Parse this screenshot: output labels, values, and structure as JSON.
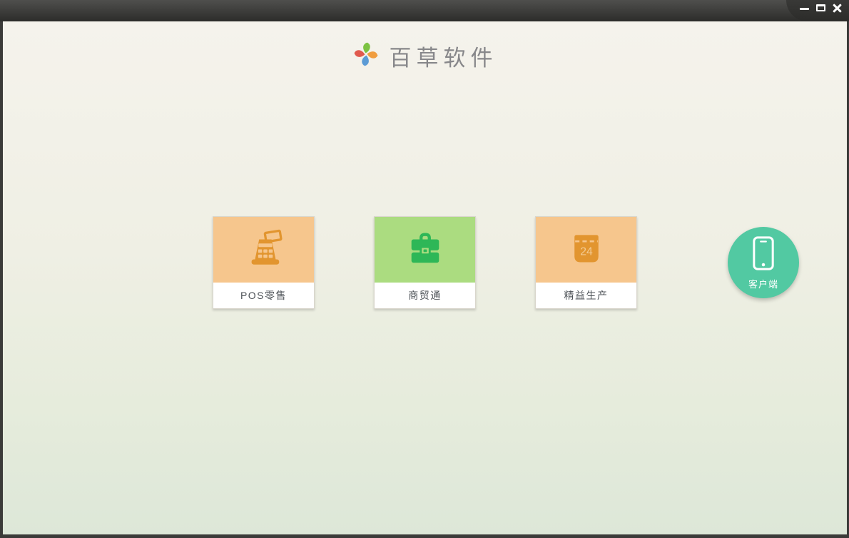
{
  "titlebar": {
    "controls": [
      {
        "name": "minimize"
      },
      {
        "name": "maximize"
      },
      {
        "name": "close"
      }
    ]
  },
  "header": {
    "app_name": "百草软件",
    "logo_icon": "pinwheel-icon",
    "logo_colors": {
      "green": "#7cc242",
      "orange": "#f09d3f",
      "blue": "#5b9bd5",
      "red": "#e05a4e"
    }
  },
  "products": [
    {
      "label": "POS零售",
      "icon": "cash-register-icon",
      "tile_color": "#f6c68d",
      "icon_color": "#e2952f"
    },
    {
      "label": "商贸通",
      "icon": "briefcase-icon",
      "tile_color": "#abdc80",
      "icon_color": "#2eb757"
    },
    {
      "label": "精益生产",
      "icon": "calendar-icon",
      "tile_color": "#f6c68d",
      "icon_color": "#e2952f",
      "calendar_day": "24"
    }
  ],
  "client_button": {
    "label": "客户端",
    "icon": "smartphone-icon",
    "color": "#52c9a2"
  },
  "colors": {
    "titlebar_top": "#4f4f4d",
    "titlebar_bottom": "#2c2c2a",
    "frame_border": "#3b3b39",
    "bg_top": "#f5f3ec",
    "bg_bottom": "#dde7d8",
    "card_label_text": "#4d5257",
    "brand_text": "#87878a"
  }
}
